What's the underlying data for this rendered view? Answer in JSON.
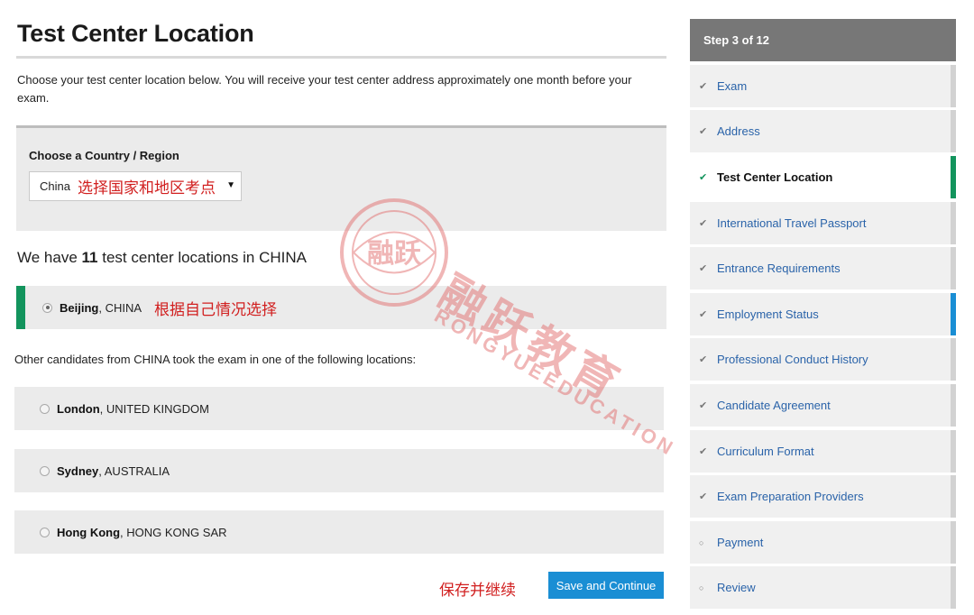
{
  "page": {
    "title": "Test Center Location",
    "intro": "Choose your test center location below. You will receive your test center address approximately one month before your exam."
  },
  "country": {
    "label": "Choose a Country / Region",
    "selected": "China",
    "annotation": "选择国家和地区考点"
  },
  "locations": {
    "count_prefix": "We have",
    "count": "11",
    "count_suffix": "test center locations in CHINA",
    "selected": {
      "city": "Beijing",
      "country": ", CHINA",
      "annotation": "根据自己情况选择"
    },
    "others_label": "Other candidates from CHINA took the exam in one of the following locations:",
    "others": [
      {
        "city": "London",
        "country": ", UNITED KINGDOM"
      },
      {
        "city": "Sydney",
        "country": ", AUSTRALIA"
      },
      {
        "city": "Hong Kong",
        "country": ", HONG KONG SAR"
      }
    ]
  },
  "actions": {
    "save_annotation": "保存并继续",
    "save_label": "Save and Continue"
  },
  "stepper": {
    "header": "Step 3 of 12",
    "items": [
      {
        "label": "Exam",
        "status": "done"
      },
      {
        "label": "Address",
        "status": "done"
      },
      {
        "label": "Test Center Location",
        "status": "current"
      },
      {
        "label": "International Travel Passport",
        "status": "done"
      },
      {
        "label": "Entrance Requirements",
        "status": "done"
      },
      {
        "label": "Employment Status",
        "status": "done"
      },
      {
        "label": "Professional Conduct History",
        "status": "done"
      },
      {
        "label": "Candidate Agreement",
        "status": "done"
      },
      {
        "label": "Curriculum Format",
        "status": "done"
      },
      {
        "label": "Exam Preparation Providers",
        "status": "done"
      },
      {
        "label": "Payment",
        "status": "pending"
      },
      {
        "label": "Review",
        "status": "pending"
      }
    ]
  },
  "watermark": {
    "text_cn": "融跃教育",
    "text_en": "RONGYUEEDUCATION",
    "seal_text": "融跃"
  },
  "colors": {
    "accent_green": "#13945d",
    "accent_blue": "#1a8ed4",
    "annotation_red": "#d11f1f",
    "step_header_gray": "#777777"
  }
}
